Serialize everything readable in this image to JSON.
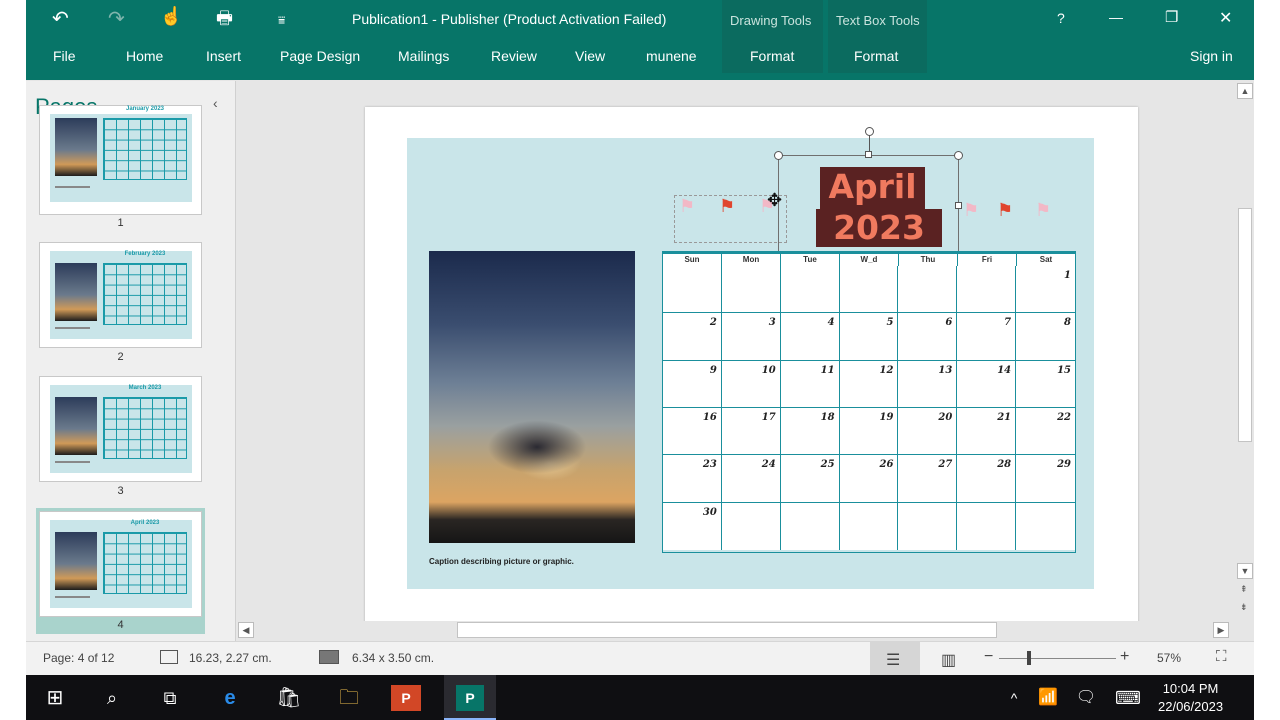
{
  "window": {
    "title": "Publication1 - Publisher (Product Activation Failed)",
    "context_drawing": "Drawing Tools",
    "context_textbox": "Text Box Tools",
    "help": "?",
    "minimize": "—",
    "restore": "❐",
    "close": "✕"
  },
  "qat": {
    "undo": "↶",
    "redo": "↷",
    "touch": "☝",
    "print": "🖶",
    "customize": "⩸"
  },
  "tabs": [
    "File",
    "Home",
    "Insert",
    "Page Design",
    "Mailings",
    "Review",
    "View",
    "munene",
    "Format",
    "Format"
  ],
  "signin": "Sign in",
  "pages_pane": {
    "title": "Pages",
    "collapse": "‹",
    "thumbnails": [
      {
        "num": "1",
        "month": "January\n2023"
      },
      {
        "num": "2",
        "month": "February\n2023"
      },
      {
        "num": "3",
        "month": "March\n2023"
      },
      {
        "num": "4",
        "month": "April\n2023"
      }
    ]
  },
  "calendar": {
    "month": "April",
    "year": "2023",
    "weekdays": [
      "Sun",
      "Mon",
      "Tue",
      "W_d",
      "Thu",
      "Fri",
      "Sat"
    ],
    "days": [
      "",
      "",
      "",
      "",
      "",
      "",
      "1",
      "2",
      "3",
      "4",
      "5",
      "6",
      "7",
      "8",
      "9",
      "10",
      "11",
      "12",
      "13",
      "14",
      "15",
      "16",
      "17",
      "18",
      "19",
      "20",
      "21",
      "22",
      "23",
      "24",
      "25",
      "26",
      "27",
      "28",
      "29",
      "30",
      "",
      "",
      "",
      "",
      "",
      ""
    ],
    "caption": "Caption describing picture or graphic."
  },
  "status": {
    "page": "Page: 4 of 12",
    "position": "16.23, 2.27 cm.",
    "size": "6.34 x  3.50 cm.",
    "zoom": "57%"
  },
  "taskbar": {
    "time": "10:04 PM",
    "date": "22/06/2023"
  },
  "colors": {
    "ribbon": "#077568",
    "canvas": "#c9e5e9",
    "grid": "#1a8f9c",
    "month_bg": "#5a2222",
    "month_text": "#f07a5f"
  }
}
